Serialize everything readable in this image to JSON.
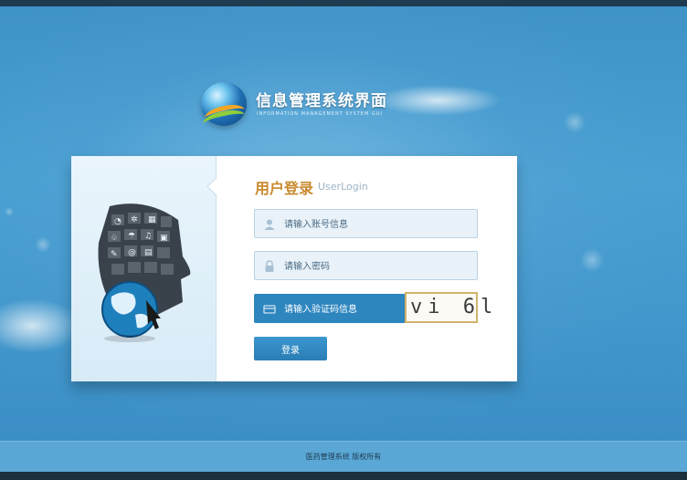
{
  "brand": {
    "title": "信息管理系统界面",
    "subtitle": "INFORMATION MANAGEMENT SYSTEM GUI"
  },
  "login": {
    "title": "用户登录",
    "subtitle": "UserLogin",
    "account_placeholder": "请输入账号信息",
    "password_placeholder": "请输入密码",
    "captcha_placeholder": "请输入验证码信息",
    "captcha_text": "vi 6l",
    "submit_label": "登录"
  },
  "footer": {
    "text": "医药管理系统 版权所有"
  },
  "colors": {
    "background": "#3f93c7",
    "accent": "#2e86bf",
    "title_orange": "#c98a2f",
    "footer_bar": "#5aa6d4"
  },
  "icons": {
    "account": "user-icon",
    "password": "lock-icon",
    "captcha": "card-icon",
    "logo": "globe-logo-icon"
  }
}
